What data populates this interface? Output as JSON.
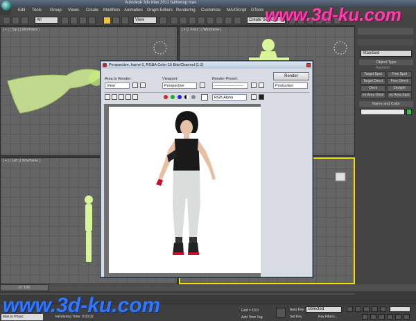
{
  "window": {
    "title": "Autodesk 3ds Max  2011      faithwrap.max"
  },
  "menu": [
    "Edit",
    "Tools",
    "Group",
    "Views",
    "Create",
    "Modifiers",
    "Animation",
    "Graph Editors",
    "Rendering",
    "Customize",
    "MAXScript",
    "DTools"
  ],
  "toolbar": {
    "selection_filter": "All",
    "coordinate_system": "View",
    "named_selection": "Create Selection Se"
  },
  "viewports": {
    "top": "[ + ] [ Top ] [ Wireframe ]",
    "front": "[ + ] [ Front ] [ Wireframe ]",
    "left": "[ + ] [ Left ] [ Wireframe ]"
  },
  "command_panel": {
    "category_dropdown": "Standard",
    "object_type_header": "Object Type",
    "autogrid": "AutoGrid",
    "buttons": [
      "Target Spot",
      "Free Spot",
      "Target Direct",
      "Free Direct",
      "Omni",
      "Skylight",
      "mr Area Omni",
      "mr Area Spot"
    ],
    "name_color_header": "Name and Color"
  },
  "render_frame": {
    "title": "Perspective, frame 0, RGBA Color 16 Bits/Channel (1:2)",
    "area_label": "Area to Render:",
    "area_value": "View",
    "viewport_label": "Viewport:",
    "viewport_value": "Perspective",
    "preset_label": "Render Preset:",
    "preset_value": "-----------------------",
    "render_button": "Render",
    "production_value": "Production",
    "channel_value": "RGB Alpha"
  },
  "timeline": {
    "frame_counter": "0 / 100"
  },
  "status": {
    "max_to_physc": "Max to Physc",
    "rendering_time": "Rendering Time: 0:00:02",
    "grid": "Grid = 10.0",
    "add_time_tag": "Add Time Tag",
    "auto_key": "Auto Key",
    "auto_key_value": "Selected",
    "set_key": "Set Key",
    "key_filters": "Key Filters..."
  },
  "watermark": {
    "top": "www.3d-ku.com",
    "bottom": "www.3d-ku.com"
  },
  "colors": {
    "accent_yellow": "#f2e000",
    "watermark_pink": "#ff3fa8",
    "watermark_blue": "#2f78ff",
    "selection_green": "#c8f07a"
  }
}
